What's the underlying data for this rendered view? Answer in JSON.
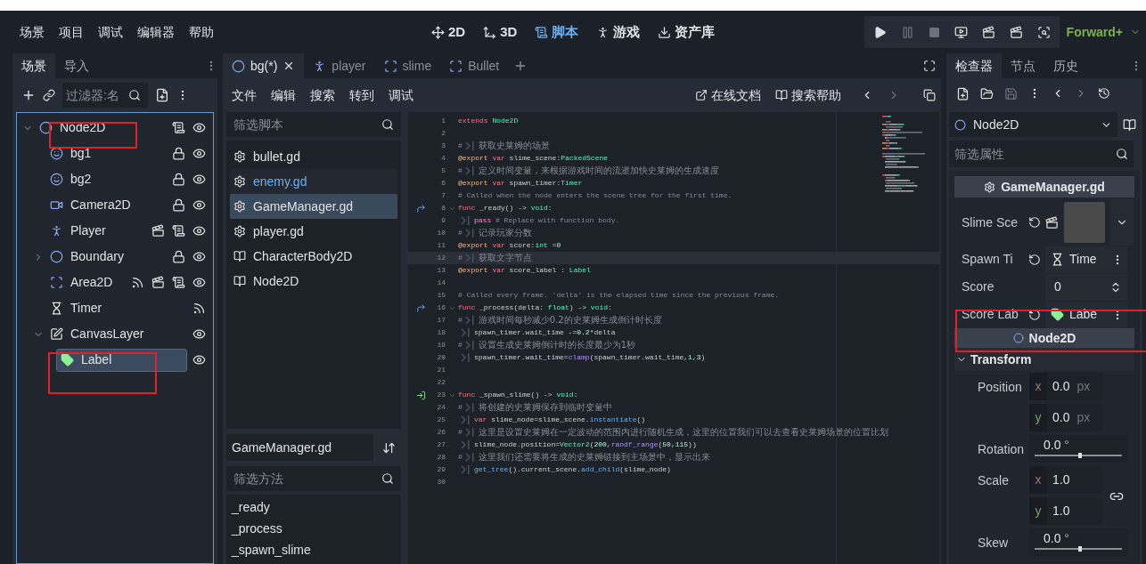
{
  "menu": [
    "场景",
    "项目",
    "调试",
    "编辑器",
    "帮助"
  ],
  "workspaces": [
    {
      "label": "2D",
      "selected": false
    },
    {
      "label": "3D",
      "selected": false
    },
    {
      "label": "脚本",
      "selected": true
    },
    {
      "label": "游戏",
      "selected": false
    },
    {
      "label": "资产库",
      "selected": false
    }
  ],
  "renderer": "Forward+",
  "scene_dock": {
    "tabs": [
      {
        "label": "场景",
        "selected": true
      },
      {
        "label": "导入",
        "selected": false
      }
    ],
    "filter_placeholder": "过滤器:名",
    "tree": [
      {
        "name": "Node2D",
        "kind": "node2d",
        "expanded": true,
        "selected": false,
        "has_signals": false,
        "is_instance": false,
        "has_script": true,
        "locked": false,
        "visible": true,
        "children": [
          {
            "name": "bg1",
            "kind": "sprite",
            "selected": false,
            "has_signals": false,
            "is_instance": false,
            "has_script": false,
            "locked": true,
            "visible": true
          },
          {
            "name": "bg2",
            "kind": "sprite",
            "selected": false,
            "has_signals": false,
            "is_instance": false,
            "has_script": false,
            "locked": true,
            "visible": true
          },
          {
            "name": "Camera2D",
            "kind": "camera",
            "selected": false,
            "has_signals": false,
            "is_instance": false,
            "has_script": false,
            "locked": true,
            "visible": true
          },
          {
            "name": "Player",
            "kind": "character",
            "selected": false,
            "has_signals": false,
            "is_instance": true,
            "has_script": true,
            "locked": false,
            "visible": true
          },
          {
            "name": "Boundary",
            "kind": "node2d",
            "expanded": false,
            "selected": false,
            "has_signals": false,
            "is_instance": false,
            "has_script": false,
            "locked": true,
            "visible": true
          },
          {
            "name": "Area2D",
            "kind": "area",
            "selected": false,
            "has_signals": true,
            "is_instance": true,
            "has_script": true,
            "locked": false,
            "visible": true
          },
          {
            "name": "Timer",
            "kind": "timer",
            "selected": false,
            "has_signals": true,
            "is_instance": false,
            "has_script": false,
            "locked": false
          },
          {
            "name": "CanvasLayer",
            "kind": "canvas",
            "expanded": true,
            "selected": false,
            "has_signals": false,
            "is_instance": false,
            "has_script": false,
            "locked": false,
            "visible": true,
            "children": [
              {
                "name": "Label",
                "kind": "label",
                "selected": true,
                "has_signals": false,
                "is_instance": false,
                "has_script": false,
                "locked": false,
                "visible": true
              }
            ]
          }
        ]
      }
    ]
  },
  "script_tabs": [
    {
      "label": "bg(*)",
      "kind": "node2d",
      "selected": true
    },
    {
      "label": "player",
      "kind": "character",
      "selected": false
    },
    {
      "label": "slime",
      "kind": "area",
      "selected": false
    },
    {
      "label": "Bullet",
      "kind": "area",
      "selected": false
    }
  ],
  "script_menu": [
    "文件",
    "编辑",
    "搜索",
    "转到",
    "调试"
  ],
  "help_links": [
    "在线文档",
    "搜索帮助"
  ],
  "script_filter_placeholder": "筛选脚本",
  "scripts": [
    {
      "name": "bullet.gd",
      "kind": "script",
      "selected": false,
      "highlighted": false
    },
    {
      "name": "enemy.gd",
      "kind": "script",
      "selected": false,
      "highlighted": true
    },
    {
      "name": "GameManager.gd",
      "kind": "script",
      "selected": true,
      "highlighted": false
    },
    {
      "name": "player.gd",
      "kind": "script",
      "selected": false,
      "highlighted": false
    },
    {
      "name": "CharacterBody2D",
      "kind": "doc",
      "selected": false,
      "highlighted": false
    },
    {
      "name": "Node2D",
      "kind": "doc",
      "selected": false,
      "highlighted": false
    }
  ],
  "current_script": "GameManager.gd",
  "method_filter_placeholder": "筛选方法",
  "methods": [
    "_ready",
    "_process",
    "_spawn_slime"
  ],
  "code": [
    {
      "n": "1",
      "selected": false,
      "segments": [
        {
          "kind": "kw",
          "text": "extends "
        },
        {
          "kind": "type",
          "text": "Node2D"
        }
      ]
    },
    {
      "n": "2",
      "selected": false
    },
    {
      "n": "3",
      "selected": false,
      "prefix": "#",
      "indent": true,
      "segments": [
        {
          "kind": "cmt",
          "text": "获取史莱姆的场景"
        }
      ]
    },
    {
      "n": "4",
      "selected": false,
      "segments": [
        {
          "kind": "annot",
          "text": "@export "
        },
        {
          "kind": "kw",
          "text": "var"
        },
        {
          "kind": "plain",
          "text": " slime_scene:"
        },
        {
          "kind": "type",
          "text": "PackedScene"
        }
      ]
    },
    {
      "n": "5",
      "selected": false,
      "prefix": "#",
      "indent": true,
      "segments": [
        {
          "kind": "cmt",
          "text": "定义时间变量，来根据游戏时间的流逝加快史莱姆的生成速度"
        }
      ]
    },
    {
      "n": "6",
      "selected": false,
      "segments": [
        {
          "kind": "annot",
          "text": "@export "
        },
        {
          "kind": "kw",
          "text": "var"
        },
        {
          "kind": "plain",
          "text": " spawn_timer:"
        },
        {
          "kind": "type",
          "text": "Timer"
        }
      ]
    },
    {
      "n": "7",
      "selected": false,
      "segments": [
        {
          "kind": "cmt",
          "text": "# Called when the node enters the scene tree for the first time."
        }
      ]
    },
    {
      "n": "8",
      "selected": false,
      "overrides": true,
      "fold": true,
      "segments": [
        {
          "kind": "kw",
          "text": "func"
        },
        {
          "kind": "plain",
          "text": " _ready() -> "
        },
        {
          "kind": "type",
          "text": "void"
        },
        {
          "kind": "plain",
          "text": ":"
        }
      ]
    },
    {
      "n": "9",
      "selected": false,
      "indent": true,
      "segments": [
        {
          "kind": "ctrl",
          "text": "pass"
        },
        {
          "kind": "cmt",
          "text": " # Replace with function body."
        }
      ]
    },
    {
      "n": "10",
      "selected": false,
      "prefix": "#",
      "indent": true,
      "segments": [
        {
          "kind": "cmt",
          "text": "记录玩家分数"
        }
      ]
    },
    {
      "n": "11",
      "selected": false,
      "segments": [
        {
          "kind": "annot",
          "text": "@export "
        },
        {
          "kind": "kw",
          "text": "var"
        },
        {
          "kind": "plain",
          "text": " score:"
        },
        {
          "kind": "type",
          "text": "int"
        },
        {
          "kind": "plain",
          "text": " ="
        },
        {
          "kind": "num",
          "text": "0"
        }
      ]
    },
    {
      "n": "12",
      "selected": true,
      "prefix": "#",
      "indent": true,
      "segments": [
        {
          "kind": "cmt",
          "text": "获取文字节点"
        }
      ]
    },
    {
      "n": "13",
      "selected": false,
      "segments": [
        {
          "kind": "annot",
          "text": "@export "
        },
        {
          "kind": "kw",
          "text": "var"
        },
        {
          "kind": "plain",
          "text": " score_label : "
        },
        {
          "kind": "type",
          "text": "Label"
        }
      ]
    },
    {
      "n": "14",
      "selected": false
    },
    {
      "n": "15",
      "selected": false,
      "segments": [
        {
          "kind": "cmt",
          "text": "# Called every frame. 'delta' is the elapsed time since the previous frame."
        }
      ]
    },
    {
      "n": "16",
      "selected": false,
      "overrides": true,
      "fold": true,
      "segments": [
        {
          "kind": "kw",
          "text": "func"
        },
        {
          "kind": "plain",
          "text": " _process(delta: "
        },
        {
          "kind": "type",
          "text": "float"
        },
        {
          "kind": "plain",
          "text": ") -> "
        },
        {
          "kind": "type",
          "text": "void"
        },
        {
          "kind": "plain",
          "text": ":"
        }
      ]
    },
    {
      "n": "17",
      "selected": false,
      "prefix": "#",
      "indent": true,
      "segments": [
        {
          "kind": "cmt",
          "text": "游戏时间每秒减少0.2的史莱姆生成倒计时长度"
        }
      ]
    },
    {
      "n": "18",
      "selected": false,
      "indent": true,
      "segments": [
        {
          "kind": "plain",
          "text": "spawn_timer.wait_time -="
        },
        {
          "kind": "num",
          "text": "0.2"
        },
        {
          "kind": "plain",
          "text": "*delta"
        }
      ]
    },
    {
      "n": "19",
      "selected": false,
      "prefix": "#",
      "indent": true,
      "segments": [
        {
          "kind": "cmt",
          "text": "设置生成史莱姆倒计时的长度最少为1秒"
        }
      ]
    },
    {
      "n": "20",
      "selected": false,
      "indent": true,
      "segments": [
        {
          "kind": "plain",
          "text": "spawn_timer.wait_time="
        },
        {
          "kind": "builtin",
          "text": "clamp"
        },
        {
          "kind": "plain",
          "text": "(spawn_timer.wait_time,"
        },
        {
          "kind": "num",
          "text": "1"
        },
        {
          "kind": "plain",
          "text": ","
        },
        {
          "kind": "num",
          "text": "3"
        },
        {
          "kind": "plain",
          "text": ")"
        }
      ]
    },
    {
      "n": "21",
      "selected": false
    },
    {
      "n": "22",
      "selected": false
    },
    {
      "n": "23",
      "selected": false,
      "signal_connected": true,
      "fold": true,
      "segments": [
        {
          "kind": "kw",
          "text": "func"
        },
        {
          "kind": "plain",
          "text": " _spawn_slime() -> "
        },
        {
          "kind": "type",
          "text": "void"
        },
        {
          "kind": "plain",
          "text": ":"
        }
      ]
    },
    {
      "n": "24",
      "selected": false,
      "prefix": "#",
      "indent": true,
      "segments": [
        {
          "kind": "cmt",
          "text": "将创建的史莱姆保存到临时变量中"
        }
      ]
    },
    {
      "n": "25",
      "selected": false,
      "indent": true,
      "segments": [
        {
          "kind": "kw",
          "text": "var"
        },
        {
          "kind": "plain",
          "text": " slime_node=slime_scene."
        },
        {
          "kind": "fn",
          "text": "instantiate"
        },
        {
          "kind": "plain",
          "text": "()"
        }
      ]
    },
    {
      "n": "26",
      "selected": false,
      "prefix": "#",
      "indent": true,
      "segments": [
        {
          "kind": "cmt",
          "text": "这里是设置史莱姆在一定波动的范围内进行随机生成，这里的位置我们可以去查看史莱姆场景的位置比划"
        }
      ]
    },
    {
      "n": "27",
      "selected": false,
      "indent": true,
      "segments": [
        {
          "kind": "plain",
          "text": "slime_node.position="
        },
        {
          "kind": "type",
          "text": "Vector2"
        },
        {
          "kind": "plain",
          "text": "("
        },
        {
          "kind": "num",
          "text": "200"
        },
        {
          "kind": "plain",
          "text": ","
        },
        {
          "kind": "builtin",
          "text": "randf_range"
        },
        {
          "kind": "plain",
          "text": "("
        },
        {
          "kind": "num",
          "text": "50"
        },
        {
          "kind": "plain",
          "text": ","
        },
        {
          "kind": "num",
          "text": "115"
        },
        {
          "kind": "plain",
          "text": "))"
        }
      ]
    },
    {
      "n": "28",
      "selected": false,
      "prefix": "#",
      "indent": true,
      "segments": [
        {
          "kind": "cmt",
          "text": "这里我们还需要将生成的史莱姆链接到主场景中，显示出来"
        }
      ]
    },
    {
      "n": "29",
      "selected": false,
      "indent": true,
      "segments": [
        {
          "kind": "fn",
          "text": "get_tree"
        },
        {
          "kind": "plain",
          "text": "().current_scene."
        },
        {
          "kind": "fn",
          "text": "add_child"
        },
        {
          "kind": "plain",
          "text": "(slime_node)"
        }
      ]
    },
    {
      "n": "30",
      "selected": false
    }
  ],
  "inspector": {
    "tabs": [
      {
        "label": "检查器",
        "selected": true
      },
      {
        "label": "节点",
        "selected": false
      },
      {
        "label": "历史",
        "selected": false
      }
    ],
    "object": "Node2D",
    "filter_placeholder": "筛选属性",
    "script_section": "GameManager.gd",
    "script_properties": [
      {
        "name": "Slime Sce",
        "kind": "resource",
        "modified": true
      },
      {
        "name": "Spawn Ti",
        "kind": "timer_ref",
        "value": "Time",
        "modified": true
      },
      {
        "name": "Score",
        "kind": "number",
        "value": "0",
        "modified": false
      },
      {
        "name": "Score Lab",
        "kind": "label_ref",
        "value": "Labe",
        "modified": true
      }
    ],
    "class_section": "Node2D",
    "group": {
      "name": "Transform",
      "expanded": true
    },
    "transform": [
      {
        "name": "Position",
        "kind": "vector",
        "linked": false,
        "components": [
          {
            "axis": "x",
            "value": "0.0",
            "unit": "px"
          },
          {
            "axis": "y",
            "value": "0.0",
            "unit": "px"
          }
        ]
      },
      {
        "name": "Rotation",
        "kind": "slider",
        "value": "0.0",
        "unit": "°",
        "level": 0.5
      },
      {
        "name": "Scale",
        "kind": "vector",
        "linked": true,
        "components": [
          {
            "axis": "x",
            "value": "1.0"
          },
          {
            "axis": "y",
            "value": "1.0"
          }
        ]
      },
      {
        "name": "Skew",
        "kind": "slider",
        "value": "0.0",
        "unit": "°",
        "level": 0.5
      }
    ]
  }
}
